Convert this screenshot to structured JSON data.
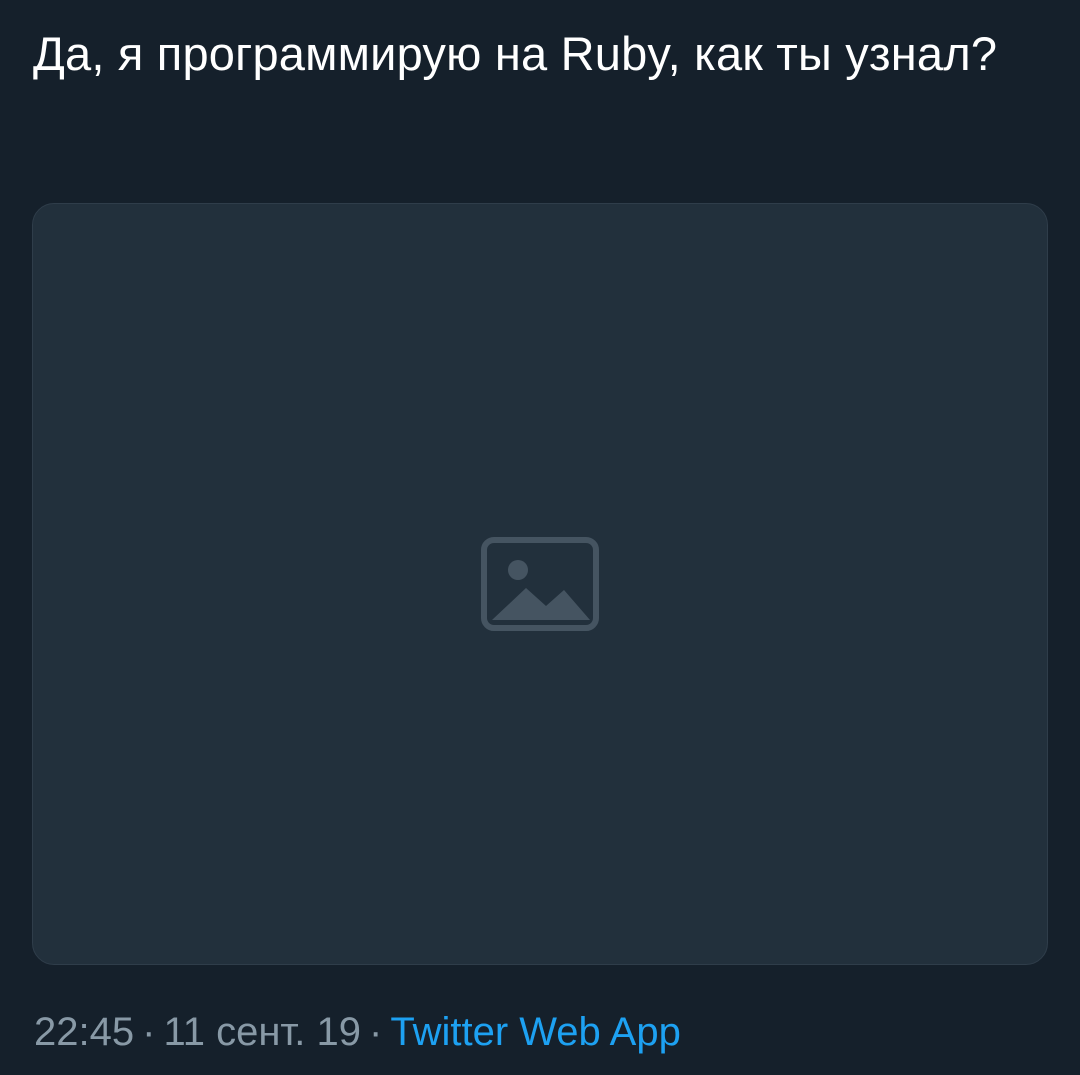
{
  "tweet": {
    "text": "Да, я программирую на Ruby, как ты узнал?",
    "media": {
      "icon": "image-icon"
    },
    "meta": {
      "time": "22:45",
      "separator": "·",
      "date": "11 сент. 19",
      "source": "Twitter Web App"
    }
  },
  "colors": {
    "background": "#15202b",
    "text": "#ffffff",
    "meta_text": "#8899a6",
    "link": "#1da1f2"
  }
}
